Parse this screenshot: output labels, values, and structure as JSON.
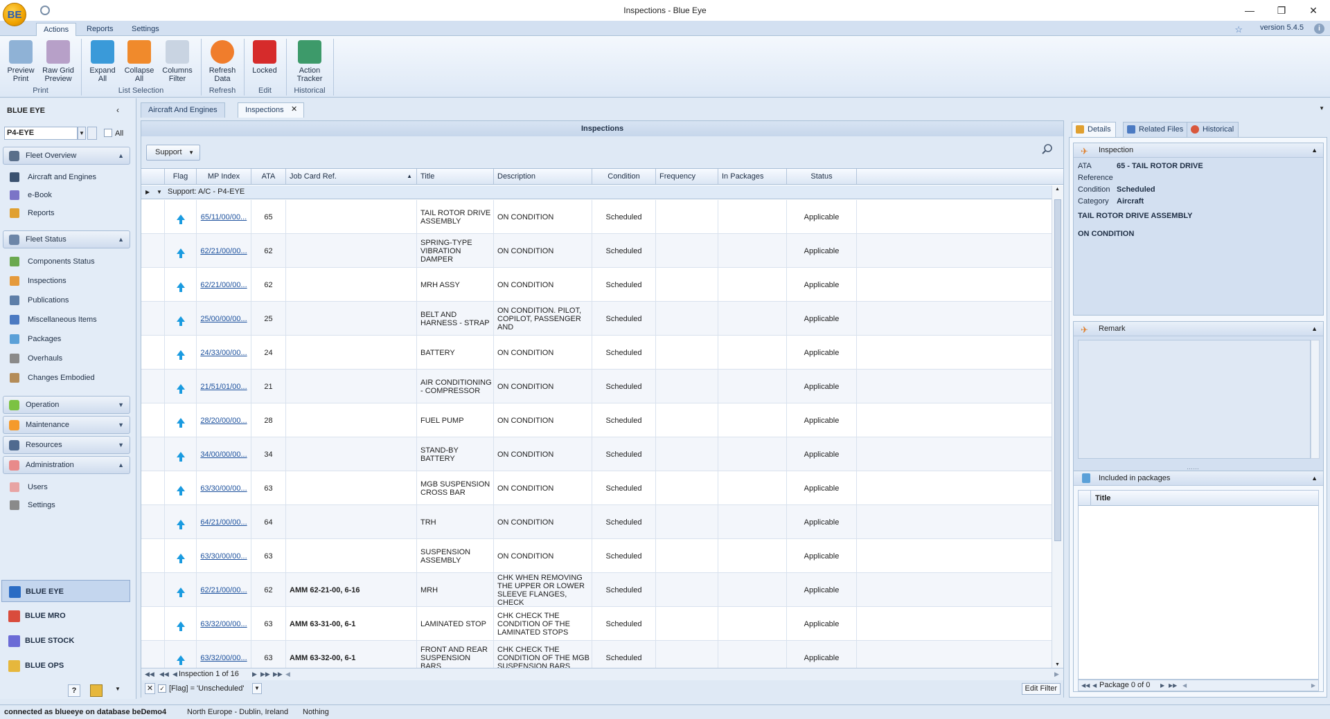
{
  "window": {
    "title": "Inspections - Blue Eye",
    "app_logo": "BE"
  },
  "ribbon_tabs": [
    {
      "label": "Actions",
      "active": true
    },
    {
      "label": "Reports",
      "active": false
    },
    {
      "label": "Settings",
      "active": false
    }
  ],
  "version": "version 5.4.5",
  "ribbon": {
    "buttons": [
      {
        "label1": "Preview",
        "label2": "Print",
        "icon": "print-preview-icon",
        "color": "#8fb2d6"
      },
      {
        "label1": "Raw Grid",
        "label2": "Preview",
        "icon": "grid-preview-icon",
        "color": "#b7a0c8"
      },
      {
        "label1": "Expand",
        "label2": "All",
        "icon": "expand-icon",
        "color": "#3a9ad9"
      },
      {
        "label1": "Collapse",
        "label2": "All",
        "icon": "collapse-icon",
        "color": "#f08a2c"
      },
      {
        "label1": "Columns",
        "label2": "Filter",
        "icon": "columns-filter-icon",
        "color": "#c9d4e2"
      },
      {
        "label1": "Refresh",
        "label2": "Data",
        "icon": "refresh-icon",
        "color": "#f07d2c"
      },
      {
        "label1": "Locked",
        "label2": "",
        "icon": "lock-icon",
        "color": "#d62b2b"
      },
      {
        "label1": "Action",
        "label2": "Tracker",
        "icon": "footprint-icon",
        "color": "#3d9a6a"
      }
    ],
    "groups": [
      "Print",
      "List Selection",
      "Refresh",
      "Edit",
      "Historical"
    ]
  },
  "left_nav": {
    "title": "BLUE EYE",
    "aircraft_select": "P4-EYE",
    "all_label": "All",
    "sections": [
      {
        "label": "Fleet Overview",
        "icon": "wrench-icon",
        "items": [
          "Aircraft and Engines",
          "e-Book",
          "Reports"
        ]
      },
      {
        "label": "Fleet Status",
        "icon": "status-icon",
        "items": [
          "Components Status",
          "Inspections",
          "Publications",
          "Miscellaneous Items",
          "Packages",
          "Overhauls",
          "Changes Embodied"
        ]
      },
      {
        "label": "Operation",
        "icon": "operation-icon"
      },
      {
        "label": "Maintenance",
        "icon": "maintenance-icon"
      },
      {
        "label": "Resources",
        "icon": "resources-icon"
      },
      {
        "label": "Administration",
        "icon": "admin-icon",
        "items": [
          "Users",
          "Settings"
        ]
      }
    ],
    "apps": [
      "BLUE EYE",
      "BLUE MRO",
      "BLUE STOCK",
      "BLUE OPS"
    ]
  },
  "doc_tabs": [
    {
      "label": "Aircraft And Engines",
      "active": false
    },
    {
      "label": "Inspections",
      "active": true
    }
  ],
  "grid": {
    "title": "Inspections",
    "filter_button": "Support",
    "columns": [
      "Flag",
      "MP Index",
      "ATA",
      "Job Card Ref.",
      "Title",
      "Description",
      "Condition",
      "Frequency",
      "In Packages",
      "Status"
    ],
    "group_label": "Support: A/C - P4-EYE",
    "rows": [
      {
        "mp": "65/11/00/00...",
        "ata": "65",
        "job": "",
        "title": "TAIL ROTOR DRIVE ASSEMBLY",
        "desc": "ON CONDITION",
        "cond": "Scheduled",
        "status": "Applicable"
      },
      {
        "mp": "62/21/00/00...",
        "ata": "62",
        "job": "",
        "title": "SPRING-TYPE VIBRATION DAMPER",
        "desc": "ON CONDITION",
        "cond": "Scheduled",
        "status": "Applicable"
      },
      {
        "mp": "62/21/00/00...",
        "ata": "62",
        "job": "",
        "title": "MRH ASSY",
        "desc": "ON CONDITION",
        "cond": "Scheduled",
        "status": "Applicable"
      },
      {
        "mp": "25/00/00/00...",
        "ata": "25",
        "job": "",
        "title": "BELT AND HARNESS - STRAP",
        "desc": "ON CONDITION. PILOT, COPILOT, PASSENGER AND",
        "cond": "Scheduled",
        "status": "Applicable"
      },
      {
        "mp": "24/33/00/00...",
        "ata": "24",
        "job": "",
        "title": "BATTERY",
        "desc": "ON CONDITION",
        "cond": "Scheduled",
        "status": "Applicable"
      },
      {
        "mp": "21/51/01/00...",
        "ata": "21",
        "job": "",
        "title": "AIR CONDITIONING - COMPRESSOR",
        "desc": "ON CONDITION",
        "cond": "Scheduled",
        "status": "Applicable"
      },
      {
        "mp": "28/20/00/00...",
        "ata": "28",
        "job": "",
        "title": "FUEL PUMP",
        "desc": "ON CONDITION",
        "cond": "Scheduled",
        "status": "Applicable"
      },
      {
        "mp": "34/00/00/00...",
        "ata": "34",
        "job": "",
        "title": "STAND-BY BATTERY",
        "desc": "ON CONDITION",
        "cond": "Scheduled",
        "status": "Applicable"
      },
      {
        "mp": "63/30/00/00...",
        "ata": "63",
        "job": "",
        "title": "MGB SUSPENSION CROSS BAR",
        "desc": "ON CONDITION",
        "cond": "Scheduled",
        "status": "Applicable"
      },
      {
        "mp": "64/21/00/00...",
        "ata": "64",
        "job": "",
        "title": "TRH",
        "desc": "ON CONDITION",
        "cond": "Scheduled",
        "status": "Applicable"
      },
      {
        "mp": "63/30/00/00...",
        "ata": "63",
        "job": "",
        "title": "SUSPENSION ASSEMBLY",
        "desc": "ON CONDITION",
        "cond": "Scheduled",
        "status": "Applicable"
      },
      {
        "mp": "62/21/00/00...",
        "ata": "62",
        "job": "AMM 62-21-00, 6-16",
        "title": "MRH",
        "desc": "CHK WHEN REMOVING THE UPPER OR LOWER SLEEVE FLANGES, CHECK",
        "cond": "Scheduled",
        "status": "Applicable"
      },
      {
        "mp": "63/32/00/00...",
        "ata": "63",
        "job": "AMM 63-31-00, 6-1",
        "title": "LAMINATED STOP",
        "desc": "CHK CHECK THE CONDITION OF THE LAMINATED STOPS",
        "cond": "Scheduled",
        "status": "Applicable"
      },
      {
        "mp": "63/32/00/00...",
        "ata": "63",
        "job": "AMM 63-32-00, 6-1",
        "title": "FRONT AND REAR SUSPENSION BARS",
        "desc": "CHK CHECK THE CONDITION OF THE MGB SUSPENSION BARS",
        "cond": "Scheduled",
        "status": "Applicable"
      }
    ],
    "navigator": "Inspection 1 of 16",
    "filter_text": "[Flag] = 'Unscheduled'",
    "edit_filter": "Edit Filter"
  },
  "right_panel": {
    "tabs": [
      {
        "label": "Details",
        "active": true
      },
      {
        "label": "Related Files",
        "active": false
      },
      {
        "label": "Historical",
        "active": false
      }
    ],
    "inspection": {
      "header": "Inspection",
      "ata_label": "ATA",
      "ata_value": "65 - TAIL ROTOR DRIVE",
      "reference_label": "Reference",
      "reference_value": "",
      "condition_label": "Condition",
      "condition_value": "Scheduled",
      "category_label": "Category",
      "category_value": "Aircraft",
      "title": "TAIL ROTOR DRIVE ASSEMBLY",
      "description": "ON CONDITION"
    },
    "remark": {
      "header": "Remark"
    },
    "packages": {
      "header": "Included in packages",
      "column": "Title",
      "navigator": "Package 0 of 0"
    }
  },
  "status_bar": {
    "connection": "connected as blueeye on database beDemo4",
    "region": "North Europe - Dublin, Ireland",
    "extra": "Nothing"
  }
}
